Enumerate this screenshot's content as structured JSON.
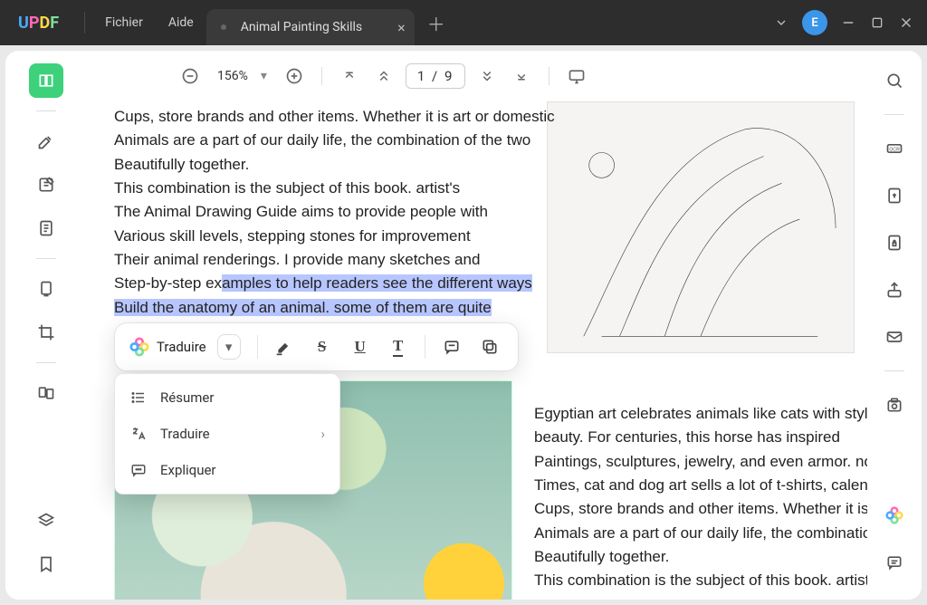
{
  "app": {
    "name": "UPDF"
  },
  "menu": {
    "file": "Fichier",
    "help": "Aide"
  },
  "tab": {
    "title": "Animal Painting Skills"
  },
  "avatar": {
    "initial": "E"
  },
  "toolbar": {
    "zoom": "156%",
    "page": "1 / 9"
  },
  "context": {
    "translate": "Traduire",
    "dropdown": {
      "summarize": "Résumer",
      "translate": "Traduire",
      "explain": "Expliquer"
    }
  },
  "text": {
    "p1": "Cups, store brands and other items. Whether it is art or domestic",
    "p2": "Animals are a part of our daily life, the combination of the two",
    "p3": "Beautifully together.",
    "p4": "This combination is the subject of this book. artist's",
    "p5": "The Animal Drawing Guide aims to provide people with",
    "p6": "Various skill levels, stepping stones for improvement",
    "p7": "Their animal renderings. I provide many sketches and",
    "p8_pre": "Step-by-step ex",
    "p8_hl": "amples to help readers see the different ways",
    "p9_hl": "Build the anatomy of an animal. some of them are quite",
    "r1": "Egyptian art celebrates animals like cats with style and",
    "r2": "beauty. For centuries, this horse has inspired",
    "r3": "Paintings, sculptures, jewelry, and even armor. nowada",
    "r4": "Times, cat and dog art sells a lot of t-shirts, calendars, ​",
    "r5": "Cups, store brands and other items. Whether it is art or",
    "r6": "Animals are a part of our daily life, the combination of t",
    "r7": "Beautifully together.",
    "r8": "This combination is the subject of this book. artist's"
  }
}
